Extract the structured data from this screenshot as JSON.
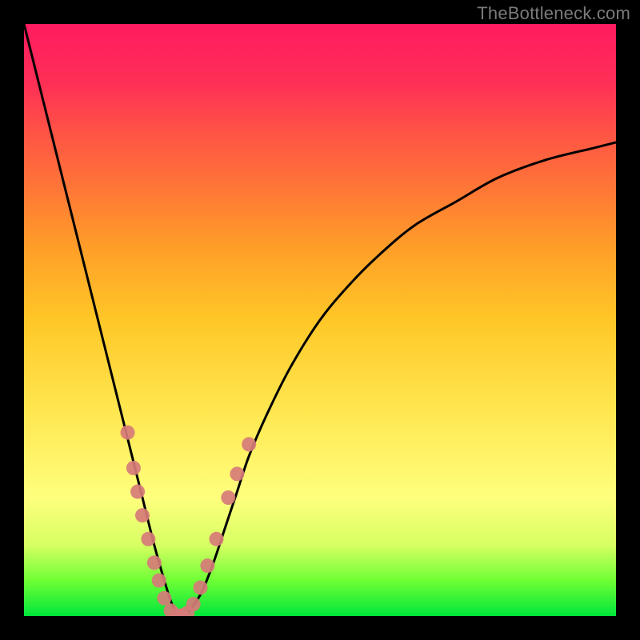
{
  "watermark": "TheBottleneck.com",
  "colors": {
    "frame": "#000000",
    "curve": "#000000",
    "marker_fill": "#d67b78",
    "marker_stroke": "#d67b78"
  },
  "chart_data": {
    "type": "line",
    "title": "",
    "xlabel": "",
    "ylabel": "",
    "xlim": [
      0,
      100
    ],
    "ylim": [
      0,
      100
    ],
    "grid": false,
    "annotations": [
      "TheBottleneck.com"
    ],
    "series": [
      {
        "name": "bottleneck-curve",
        "x": [
          0,
          2,
          4,
          6,
          8,
          10,
          12,
          14,
          16,
          18,
          20,
          22,
          24,
          25,
          26,
          27,
          28,
          30,
          32,
          34,
          36,
          38,
          41,
          45,
          50,
          55,
          60,
          66,
          73,
          80,
          88,
          96,
          100
        ],
        "y": [
          100,
          92,
          84,
          76,
          68,
          60,
          52,
          44,
          36,
          28,
          20,
          12,
          5,
          2,
          0,
          0,
          1,
          4,
          9,
          15,
          21,
          27,
          34,
          42,
          50,
          56,
          61,
          66,
          70,
          74,
          77,
          79,
          80
        ]
      }
    ],
    "markers": [
      {
        "x": 17.5,
        "y": 31
      },
      {
        "x": 18.5,
        "y": 25
      },
      {
        "x": 19.2,
        "y": 21
      },
      {
        "x": 20.0,
        "y": 17
      },
      {
        "x": 21.0,
        "y": 13
      },
      {
        "x": 22.0,
        "y": 9
      },
      {
        "x": 22.8,
        "y": 6
      },
      {
        "x": 23.7,
        "y": 3
      },
      {
        "x": 24.8,
        "y": 0.9
      },
      {
        "x": 25.7,
        "y": 0.1
      },
      {
        "x": 26.7,
        "y": 0.1
      },
      {
        "x": 27.6,
        "y": 0.5
      },
      {
        "x": 28.6,
        "y": 2.0
      },
      {
        "x": 29.8,
        "y": 4.8
      },
      {
        "x": 31.0,
        "y": 8.5
      },
      {
        "x": 32.5,
        "y": 13
      },
      {
        "x": 34.5,
        "y": 20
      },
      {
        "x": 36.0,
        "y": 24
      },
      {
        "x": 38.0,
        "y": 29
      }
    ]
  }
}
